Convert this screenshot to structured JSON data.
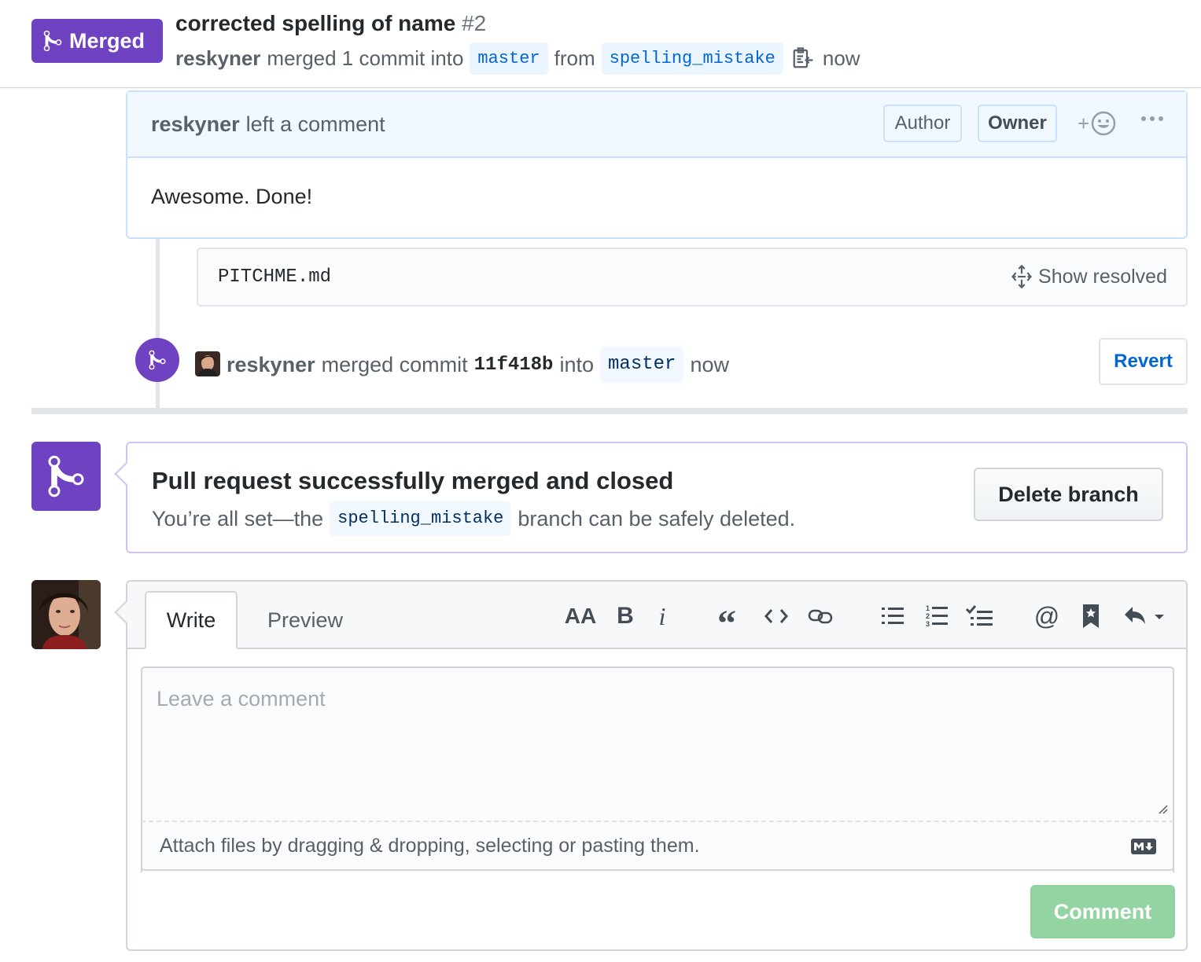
{
  "header": {
    "state_label": "Merged",
    "title": "corrected spelling of name",
    "number": "#2",
    "author": "reskyner",
    "merged_text": "merged 1 commit into",
    "base_branch": "master",
    "from_text": "from",
    "head_branch": "spelling_mistake",
    "time": "now"
  },
  "comment": {
    "author": "reskyner",
    "action": "left a comment",
    "labels": [
      "Author",
      "Owner"
    ],
    "body": "Awesome. Done!"
  },
  "file": {
    "name": "PITCHME.md",
    "show_resolved": "Show resolved"
  },
  "merge_event": {
    "author": "reskyner",
    "text": "merged commit",
    "sha": "11f418b",
    "into": "into",
    "branch": "master",
    "time": "now",
    "revert_label": "Revert"
  },
  "merge_status": {
    "title": "Pull request successfully merged and closed",
    "desc_prefix": "You’re all set—the",
    "branch": "spelling_mistake",
    "desc_suffix": "branch can be safely deleted.",
    "delete_label": "Delete branch"
  },
  "form": {
    "tabs": [
      "Write",
      "Preview"
    ],
    "placeholder": "Leave a comment",
    "attach_text": "Attach files by dragging & dropping, selecting or pasting them.",
    "submit_label": "Comment"
  },
  "colors": {
    "merged_purple": "#6f42c1",
    "link_blue": "#0366d6",
    "disabled_green": "#94d3a2"
  }
}
